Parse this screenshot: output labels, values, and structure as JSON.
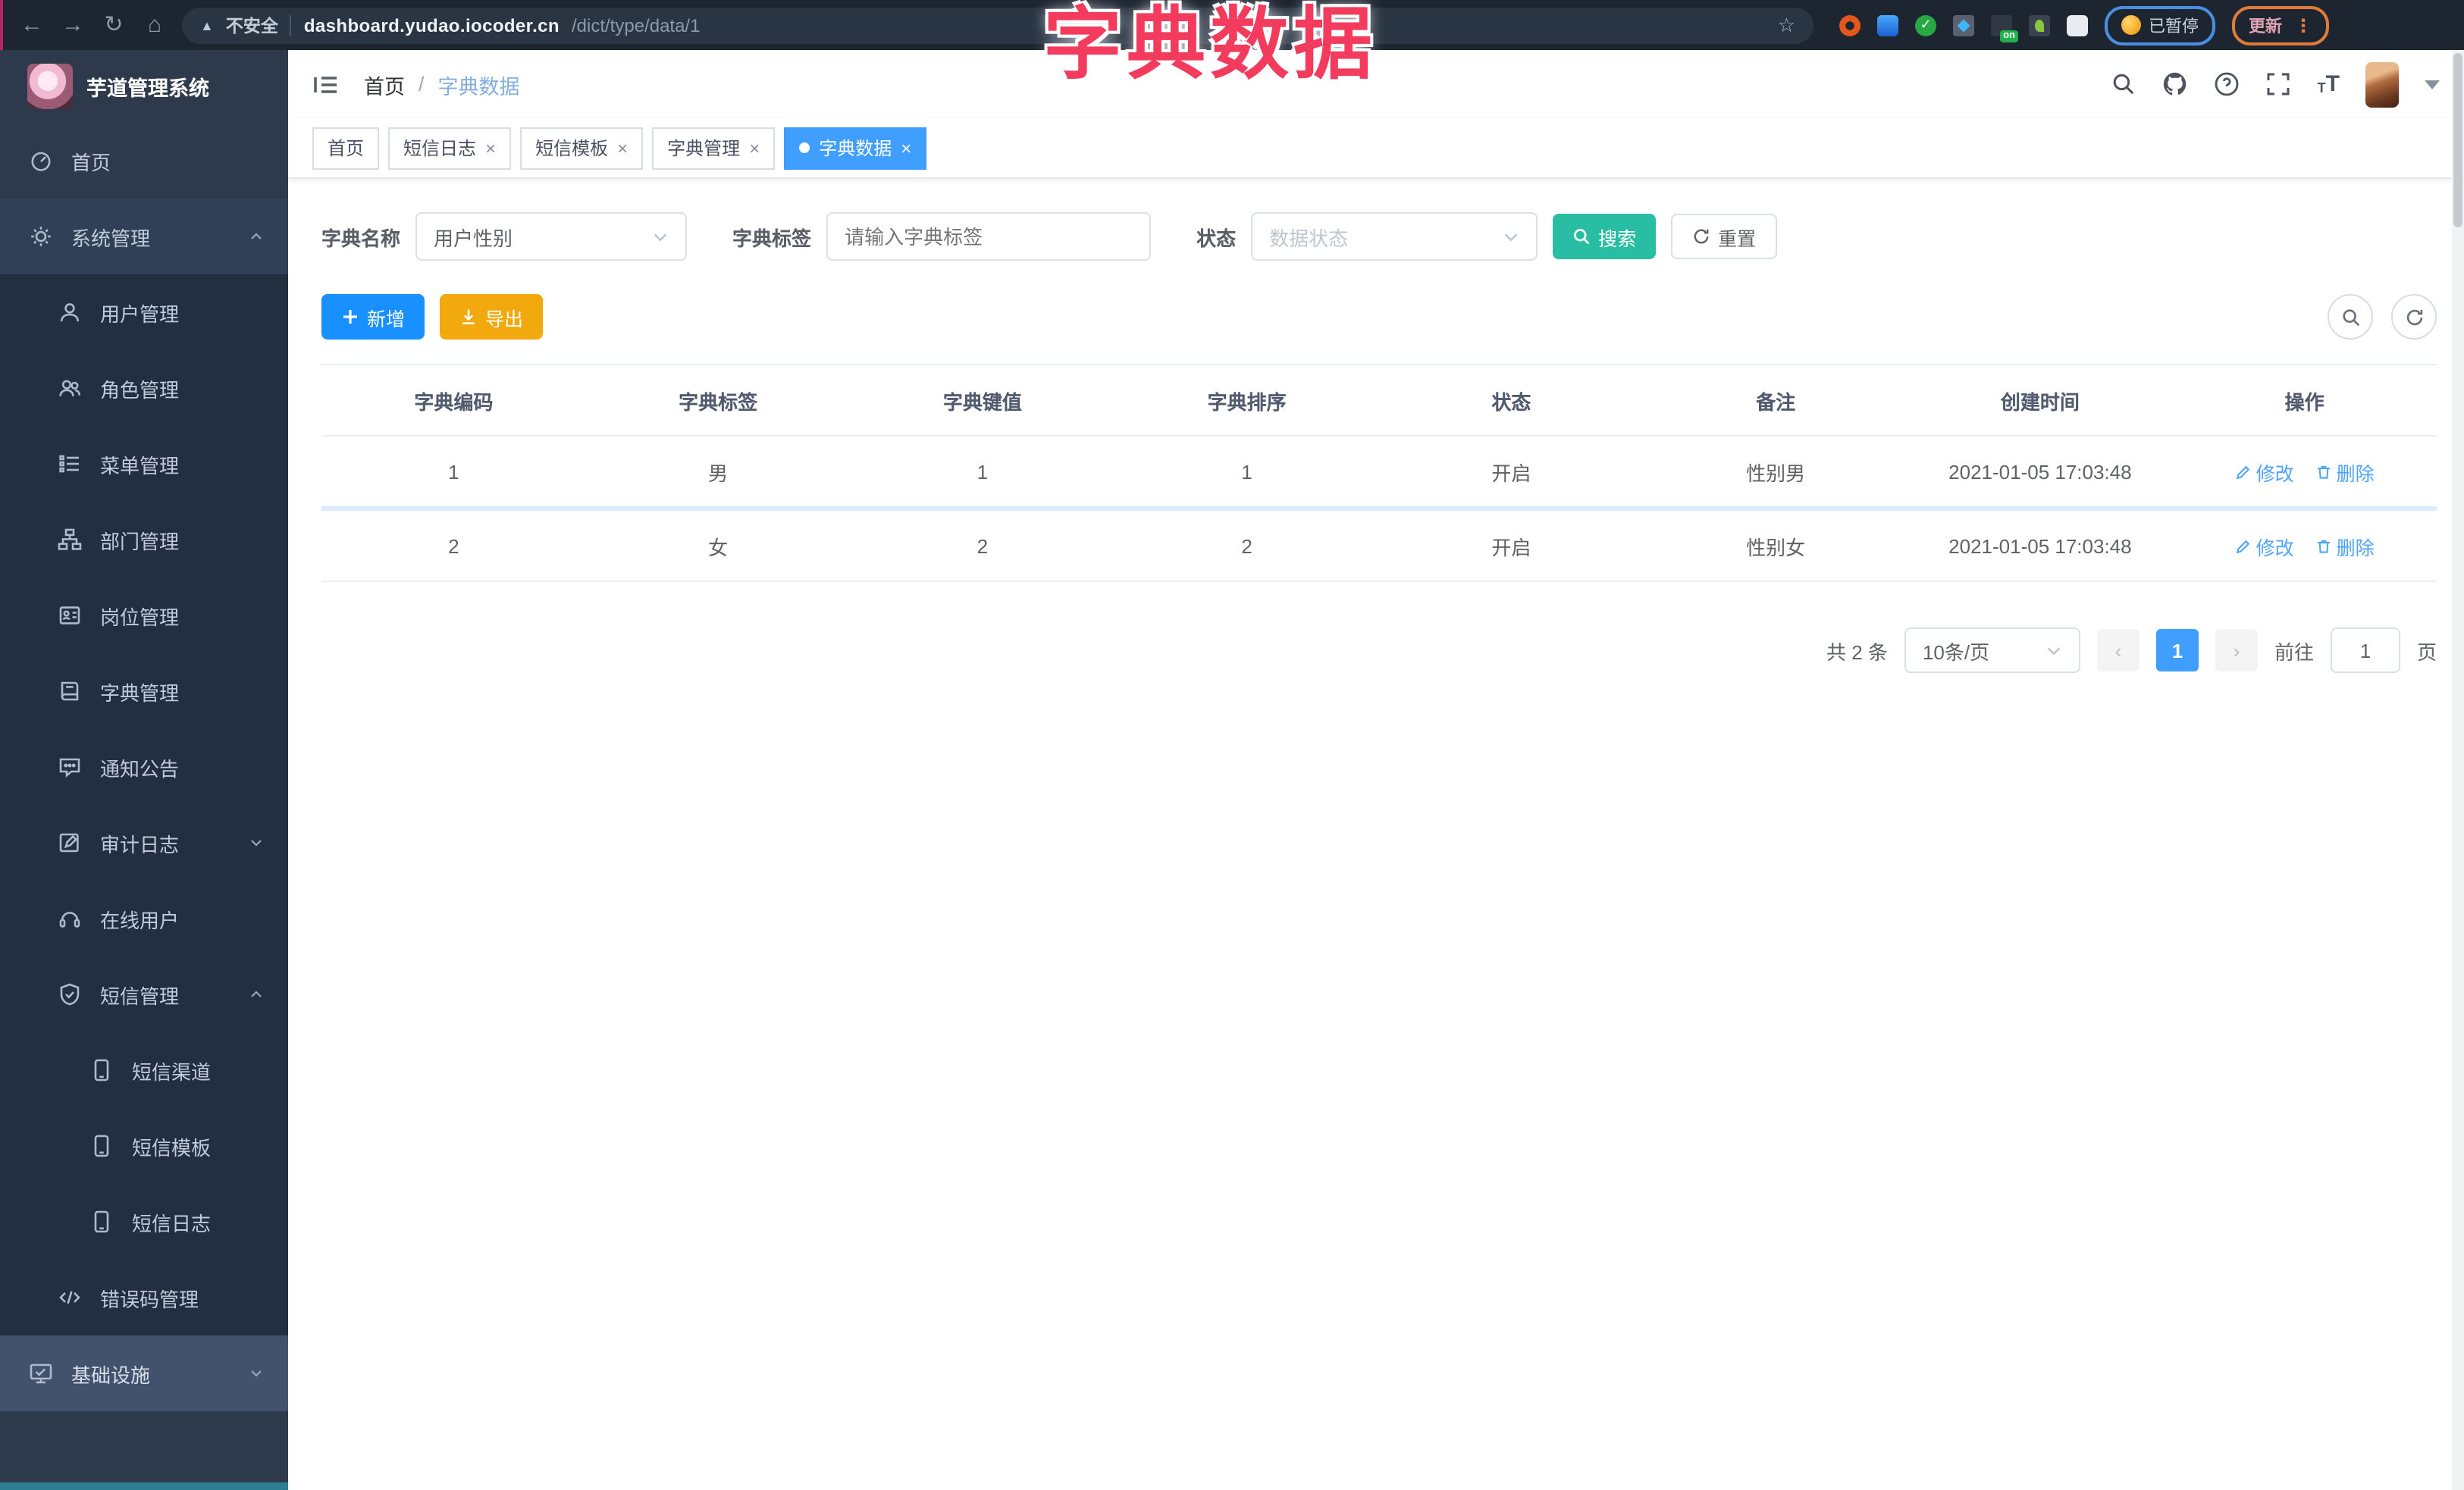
{
  "browser": {
    "security_label": "不安全",
    "url_domain": "dashboard.yudao.iocoder.cn",
    "url_path": "/dict/type/data/1",
    "ext_on_badge": "on",
    "profile_badge": "已暂停",
    "update_label": "更新"
  },
  "overlay_title": "字典数据",
  "sidebar": {
    "app_title": "芋道管理系统",
    "items": [
      {
        "label": "首页"
      },
      {
        "label": "系统管理"
      },
      {
        "label": "用户管理"
      },
      {
        "label": "角色管理"
      },
      {
        "label": "菜单管理"
      },
      {
        "label": "部门管理"
      },
      {
        "label": "岗位管理"
      },
      {
        "label": "字典管理"
      },
      {
        "label": "通知公告"
      },
      {
        "label": "审计日志"
      },
      {
        "label": "在线用户"
      },
      {
        "label": "短信管理"
      },
      {
        "label": "短信渠道"
      },
      {
        "label": "短信模板"
      },
      {
        "label": "短信日志"
      },
      {
        "label": "错误码管理"
      },
      {
        "label": "基础设施"
      }
    ]
  },
  "header": {
    "breadcrumb_home": "首页",
    "breadcrumb_sep": "/",
    "breadcrumb_current": "字典数据"
  },
  "tabs": [
    {
      "label": "首页"
    },
    {
      "label": "短信日志"
    },
    {
      "label": "短信模板"
    },
    {
      "label": "字典管理"
    },
    {
      "label": "字典数据"
    }
  ],
  "filters": {
    "dict_name_label": "字典名称",
    "dict_name_value": "用户性别",
    "dict_label_label": "字典标签",
    "dict_label_placeholder": "请输入字典标签",
    "status_label": "状态",
    "status_placeholder": "数据状态",
    "search_label": "搜索",
    "reset_label": "重置"
  },
  "toolbar": {
    "add_label": "新增",
    "export_label": "导出"
  },
  "table": {
    "headers": [
      "字典编码",
      "字典标签",
      "字典键值",
      "字典排序",
      "状态",
      "备注",
      "创建时间",
      "操作"
    ],
    "edit_label": "修改",
    "delete_label": "删除",
    "rows": [
      {
        "code": "1",
        "label": "男",
        "value": "1",
        "sort": "1",
        "status": "开启",
        "remark": "性别男",
        "created": "2021-01-05 17:03:48"
      },
      {
        "code": "2",
        "label": "女",
        "value": "2",
        "sort": "2",
        "status": "开启",
        "remark": "性别女",
        "created": "2021-01-05 17:03:48"
      }
    ]
  },
  "pagination": {
    "total": "共 2 条",
    "page_size": "10条/页",
    "current": "1",
    "goto_label": "前往",
    "goto_value": "1",
    "page_unit": "页"
  },
  "colors": {
    "accent_blue": "#409eff",
    "add_blue": "#1890ff",
    "search_teal": "#29bda4",
    "export_orange": "#f2a90d",
    "annotation_pink": "#f33b5e",
    "sidebar_bg": "#2d3a4b",
    "submenu_bg": "#212f40"
  }
}
